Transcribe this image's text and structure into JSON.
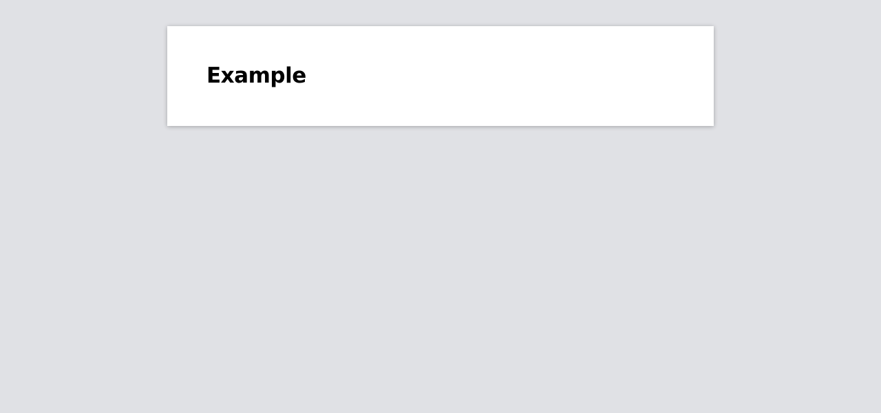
{
  "page": {
    "background_color": "#e0e1e5"
  },
  "card": {
    "title": "Example",
    "background_color": "#ffffff"
  }
}
